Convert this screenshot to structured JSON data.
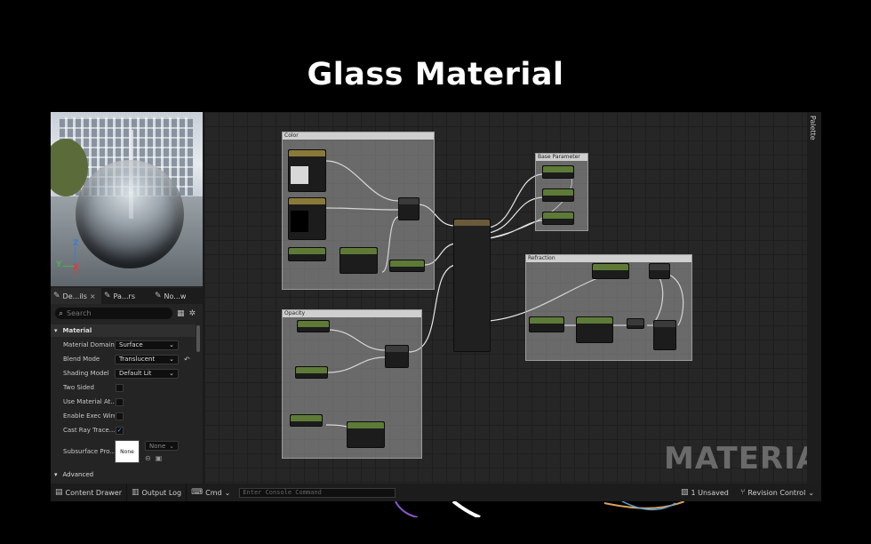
{
  "page_title": "Glass Material",
  "left_panel": {
    "tabs": [
      {
        "label": "De...ils",
        "close": "×"
      },
      {
        "label": "Pa...rs"
      },
      {
        "label": "No...w"
      }
    ],
    "search_placeholder": "Search",
    "section_material": "Material",
    "section_advanced": "Advanced",
    "properties": {
      "material_domain": {
        "label": "Material Domain",
        "value": "Surface"
      },
      "blend_mode": {
        "label": "Blend Mode",
        "value": "Translucent"
      },
      "shading_model": {
        "label": "Shading Model",
        "value": "Default Lit"
      },
      "two_sided": {
        "label": "Two Sided"
      },
      "use_material_at": {
        "label": "Use Material At..."
      },
      "enable_exec_wire": {
        "label": "Enable Exec Wire"
      },
      "cast_ray_trace": {
        "label": "Cast Ray Trace...",
        "checked_glyph": "✓"
      },
      "subsurface_pro": {
        "label": "Subsurface Pro...",
        "swatch": "None",
        "dropdown": "None"
      }
    },
    "axes": {
      "z": "Z",
      "y": "Y",
      "x": "X"
    }
  },
  "graph": {
    "comment_color": "Color",
    "comment_opacity": "Opacity",
    "comment_base_params": "Base Parameter",
    "comment_refraction": "Refraction",
    "watermark": "MATERIAL",
    "palette": "Palette"
  },
  "bottom_bar": {
    "content_drawer": "Content Drawer",
    "output_log": "Output Log",
    "cmd": "Cmd",
    "console_placeholder": "Enter Console Command",
    "unsaved": "1 Unsaved",
    "revision_control": "Revision Control"
  },
  "colors": {
    "node_green": "#5d7a37",
    "node_tex": "#8a7a3a",
    "check_blue": "#4aa3ff"
  }
}
